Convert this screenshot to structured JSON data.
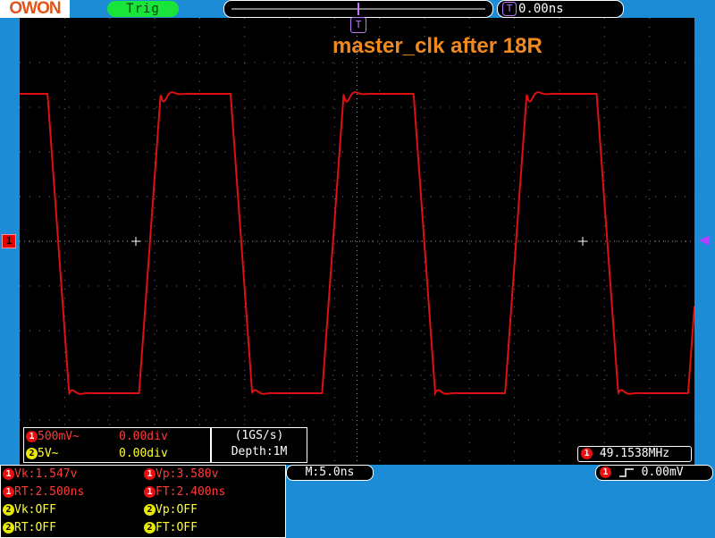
{
  "header": {
    "logo": "OWON",
    "trig_status": "Trig",
    "trigger_marker": "T",
    "trigger_delay": "0.00ns"
  },
  "annotation": "master_clk after 18R",
  "markers": {
    "ch1": "1"
  },
  "channels": [
    {
      "badge": "1",
      "scale": "500mV~",
      "offset": "0.00div",
      "color": "#e81010"
    },
    {
      "badge": "2",
      "scale": "5V~",
      "offset": "0.00div",
      "color": "#e8e800"
    }
  ],
  "acquisition": {
    "sample_rate": "(1GS/s)",
    "depth": "Depth:1M"
  },
  "frequency": {
    "badge": "1",
    "value": "49.1538MHz"
  },
  "timebase": "M:5.0ns",
  "trigger": {
    "badge": "1",
    "symbol": "┐┌",
    "level": "0.00mV"
  },
  "measurements": {
    "left": [
      {
        "badge": "1",
        "text": "Vk:1.547v"
      },
      {
        "badge": "1",
        "text": "RT:2.500ns"
      },
      {
        "badge": "2",
        "text": "Vk:OFF"
      },
      {
        "badge": "2",
        "text": "RT:OFF"
      }
    ],
    "right": [
      {
        "badge": "1",
        "text": "Vp:3.580v"
      },
      {
        "badge": "1",
        "text": "FT:2.400ns"
      },
      {
        "badge": "2",
        "text": "Vp:OFF"
      },
      {
        "badge": "2",
        "text": "FT:OFF"
      }
    ]
  },
  "waveform": {
    "color": "#e01010",
    "frequency_mhz": 49.1538,
    "timebase_ns_per_div": 5.0,
    "high_level_div": 3.3,
    "low_level_div": -3.4,
    "edge_time_ns": 2.4
  }
}
